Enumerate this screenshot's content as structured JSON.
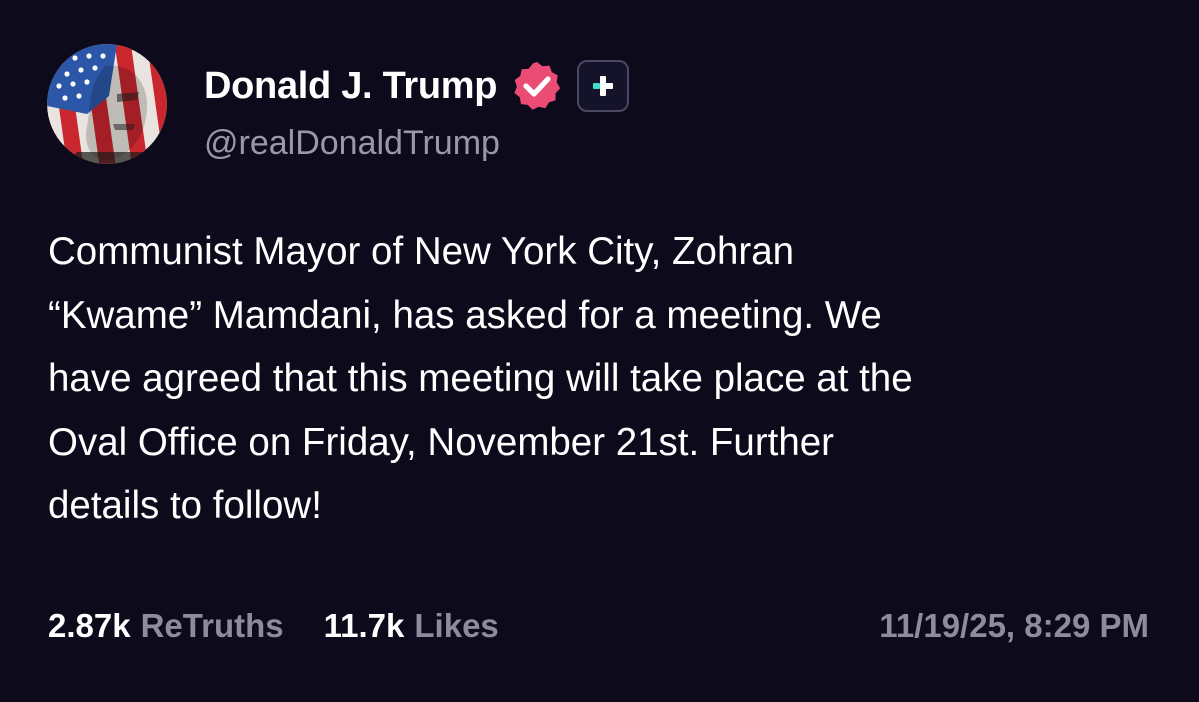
{
  "author": {
    "display_name": "Donald J. Trump",
    "handle": "@realDonaldTrump",
    "avatar_icon": "profile-avatar",
    "verified_icon": "verified-check-icon",
    "subscribe_icon": "plus-icon",
    "verified_color": "#ea4c74",
    "plus_accent_color": "#3ee0c8"
  },
  "post": {
    "lines": [
      "Communist Mayor of New York City, Zohran",
      "“Kwame” Mamdani, has asked for a meeting. We",
      "have agreed that this meeting will take place at the",
      "Oval Office on Friday, November 21st. Further",
      "details to follow!"
    ]
  },
  "stats": {
    "retruths_count": "2.87k",
    "retruths_label": "ReTruths",
    "likes_count": "11.7k",
    "likes_label": "Likes",
    "timestamp": "11/19/25, 8:29 PM"
  },
  "theme": {
    "background": "#0c0a1b",
    "text_primary": "#ffffff",
    "text_secondary": "#8e8b9c"
  }
}
